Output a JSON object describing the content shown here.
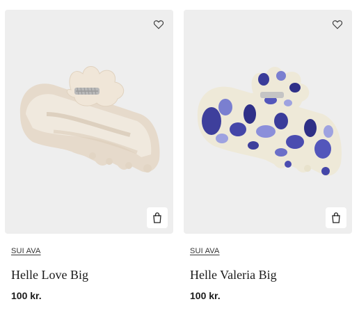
{
  "products": [
    {
      "brand": "SUI AVA",
      "name": "Helle Love Big",
      "price": "100 kr.",
      "image_icon": "hair-claw-clip-pearl",
      "colors": {
        "base": "#e8ddd0",
        "shade": "#d3c2ad",
        "light": "#f6efe6"
      }
    },
    {
      "brand": "SUI AVA",
      "name": "Helle Valeria Big",
      "price": "100 kr.",
      "image_icon": "hair-claw-clip-blue-tortoise",
      "colors": {
        "base": "#eee9d8",
        "shade": "#3f3fa0",
        "light": "#8c8fd6"
      }
    }
  ],
  "icons": {
    "wishlist": "heart-icon",
    "cart": "shopping-bag-icon"
  }
}
